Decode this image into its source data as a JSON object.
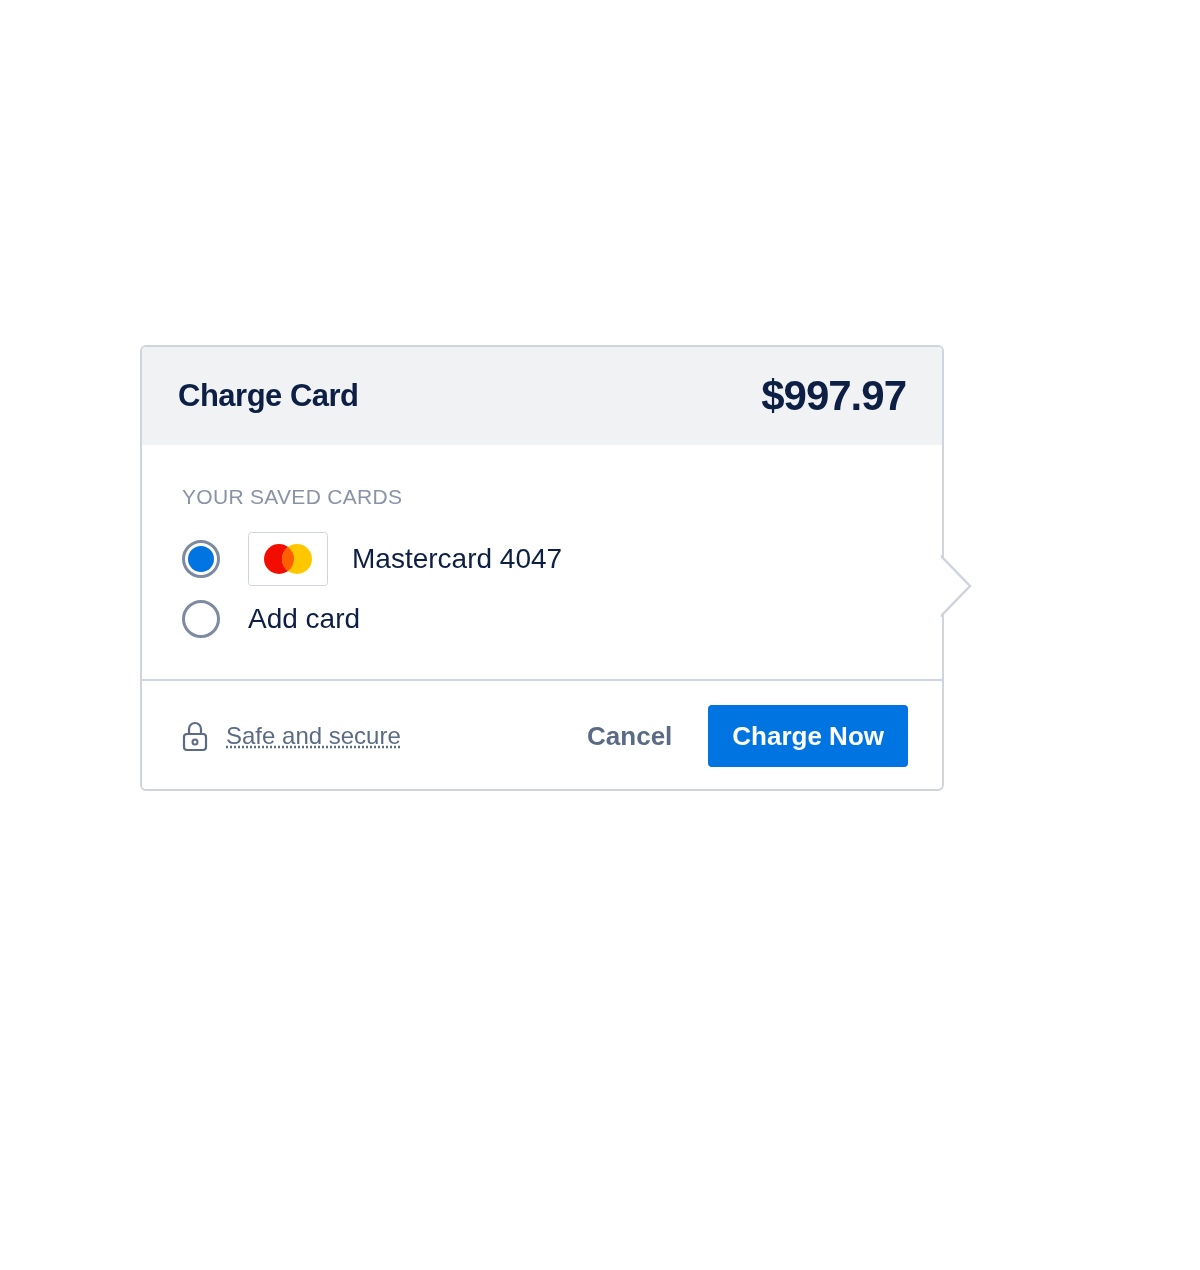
{
  "header": {
    "title": "Charge Card",
    "amount": "$997.97"
  },
  "section_label": "YOUR SAVED CARDS",
  "options": [
    {
      "kind": "card",
      "label": "Mastercard 4047",
      "selected": true
    },
    {
      "kind": "add",
      "label": "Add card",
      "selected": false
    }
  ],
  "footer": {
    "secure_link": "Safe and secure",
    "cancel": "Cancel",
    "submit": "Charge Now"
  }
}
